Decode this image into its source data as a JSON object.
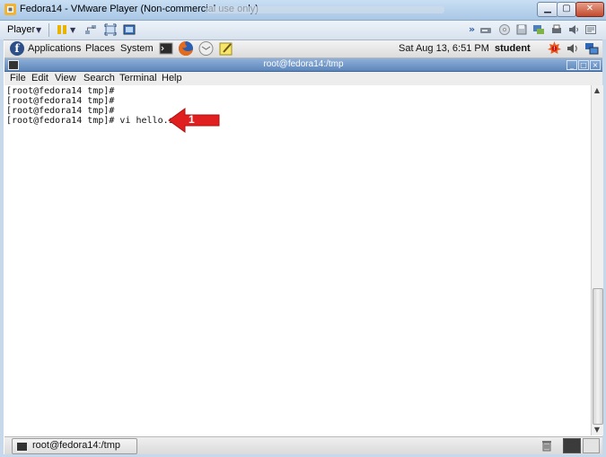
{
  "vmware": {
    "title": "Fedora14 - VMware Player (Non-commercial use only)",
    "player_menu": "Player"
  },
  "gnome": {
    "applications": "Applications",
    "places": "Places",
    "system": "System",
    "clock": "Sat Aug 13,  6:51 PM",
    "user": "student"
  },
  "terminal": {
    "title": "root@fedora14:/tmp",
    "menu": [
      "File",
      "Edit",
      "View",
      "Search",
      "Terminal",
      "Help"
    ],
    "lines": [
      "[root@fedora14 tmp]#",
      "[root@fedora14 tmp]#",
      "[root@fedora14 tmp]#",
      "[root@fedora14 tmp]# vi hello.sh"
    ]
  },
  "callout": {
    "number": "1",
    "color": "#e02020"
  },
  "taskbar": {
    "window_label": "root@fedora14:/tmp"
  },
  "colors": {
    "vm_title": "#b8d3ee",
    "term_title": "#6f95c5",
    "callout": "#e02020"
  }
}
